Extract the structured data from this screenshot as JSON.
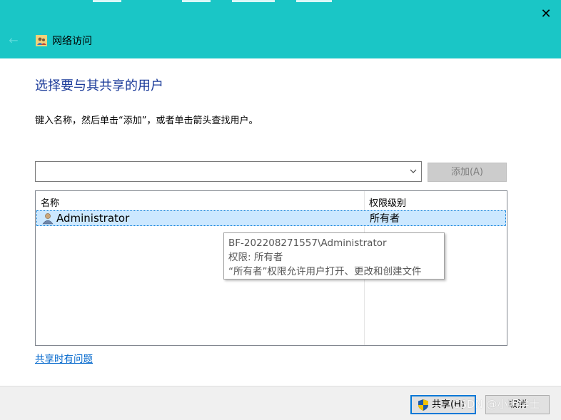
{
  "window": {
    "title": "网络访问",
    "back_icon": "back-arrow-icon",
    "close_icon": "close-icon"
  },
  "colors": {
    "titlebar": "#1ac6c6",
    "heading": "#1a3a99",
    "link": "#0066cc",
    "selection": "#cce8ff",
    "focus": "#0078d7"
  },
  "main": {
    "heading": "选择要与其共享的用户",
    "instruction": "键入名称，然后单击“添加”，或者单击箭头查找用户。",
    "user_input": {
      "value": ""
    },
    "add_button": "添加(A)"
  },
  "table": {
    "columns": [
      "名称",
      "权限级别"
    ],
    "rows": [
      {
        "name": "Administrator",
        "permission": "所有者",
        "icon": "user-icon",
        "selected": true
      }
    ]
  },
  "tooltip": {
    "line1": "BF-202208271557\\Administrator",
    "line2": "权限: 所有者",
    "line3": "“所有者”权限允许用户打开、更改和创建文件"
  },
  "help_link": "共享时有问题",
  "footer": {
    "share_button": "共享(H)",
    "cancel_button": "取消"
  },
  "watermark": "CSDN @小明学士"
}
